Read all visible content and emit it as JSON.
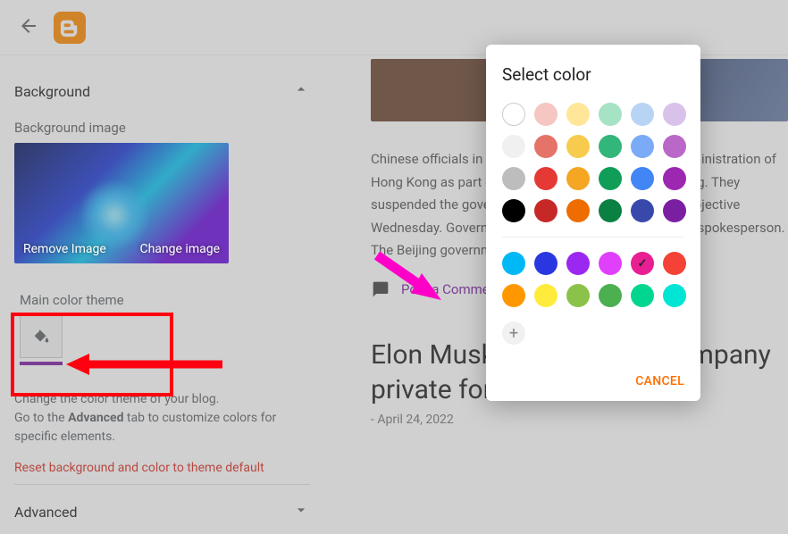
{
  "topbar": {
    "back": "Back",
    "app": "Blogger"
  },
  "sidebar": {
    "background": {
      "title": "Background",
      "image_label": "Background image",
      "remove": "Remove Image",
      "change": "Change image"
    },
    "theme": {
      "title": "Main color theme",
      "help_line1": "Change the color theme of your blog.",
      "help_line2a": "Go to the ",
      "help_line2b": "Advanced",
      "help_line2c": " tab to customize colors for specific elements.",
      "reset": "Reset background and color to theme default"
    },
    "advanced": {
      "title": "Advanced"
    }
  },
  "preview": {
    "paragraph": "Chinese officials in Hong Kong have shut down the administration of Hong Kong as part of a crackdown on foreign interfering. They suspended the government on Tuesday with the sole objective Wednesday. Government spokesperson, Tom, has said spokesperson. The Beijing government activated the J",
    "post_comment": "Post a Comment",
    "article_title": "Elon Musk plans to take company private for $54 billion",
    "article_date": "- April 24, 2022"
  },
  "popover": {
    "title": "Select color",
    "cancel": "CANCEL",
    "rows": [
      [
        "outline:#ffffff",
        "#f5c6c2",
        "#ffe699",
        "#a5e3c4",
        "#b8d4f5",
        "#d9c2ea"
      ],
      [
        "#f0f0f0",
        "#e57368",
        "#f7cb4d",
        "#33b679",
        "#7baaf7",
        "#ba68c8"
      ],
      [
        "#bdbdbd",
        "#e53935",
        "#f5a623",
        "#0f9d58",
        "#4285f4",
        "#9c27b0"
      ],
      [
        "#000000",
        "#c62828",
        "#ef6c00",
        "#0b8043",
        "#3949ab",
        "#7b1fa2"
      ]
    ],
    "custom_row": [
      "#00b8f5",
      "#2a36e0",
      "#9c27f0",
      "#e040fb",
      "check:#e91e92",
      "#f44336"
    ],
    "custom_row2": [
      "#ff9800",
      "#ffeb3b",
      "#8bc34a",
      "#4caf50",
      "#00d68f",
      "#00e5d4"
    ]
  }
}
